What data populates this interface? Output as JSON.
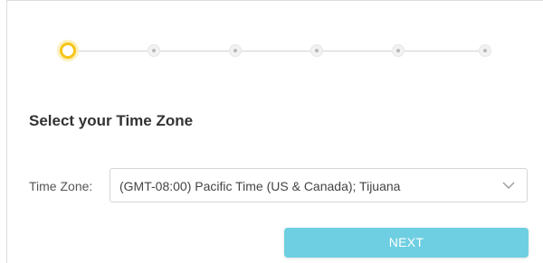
{
  "wizard": {
    "total_steps": 6,
    "current_step": 1,
    "accent_color": "#f5c518",
    "inactive_color": "#b9b9b9"
  },
  "timezone_page": {
    "title": "Select your Time Zone",
    "timezone_label": "Time Zone:",
    "timezone_selected": "(GMT-08:00) Pacific Time (US & Canada); Tijuana",
    "dropdown_icon": "chevron-down-icon"
  },
  "actions": {
    "next_label": "NEXT",
    "next_color": "#6fcfe2"
  }
}
